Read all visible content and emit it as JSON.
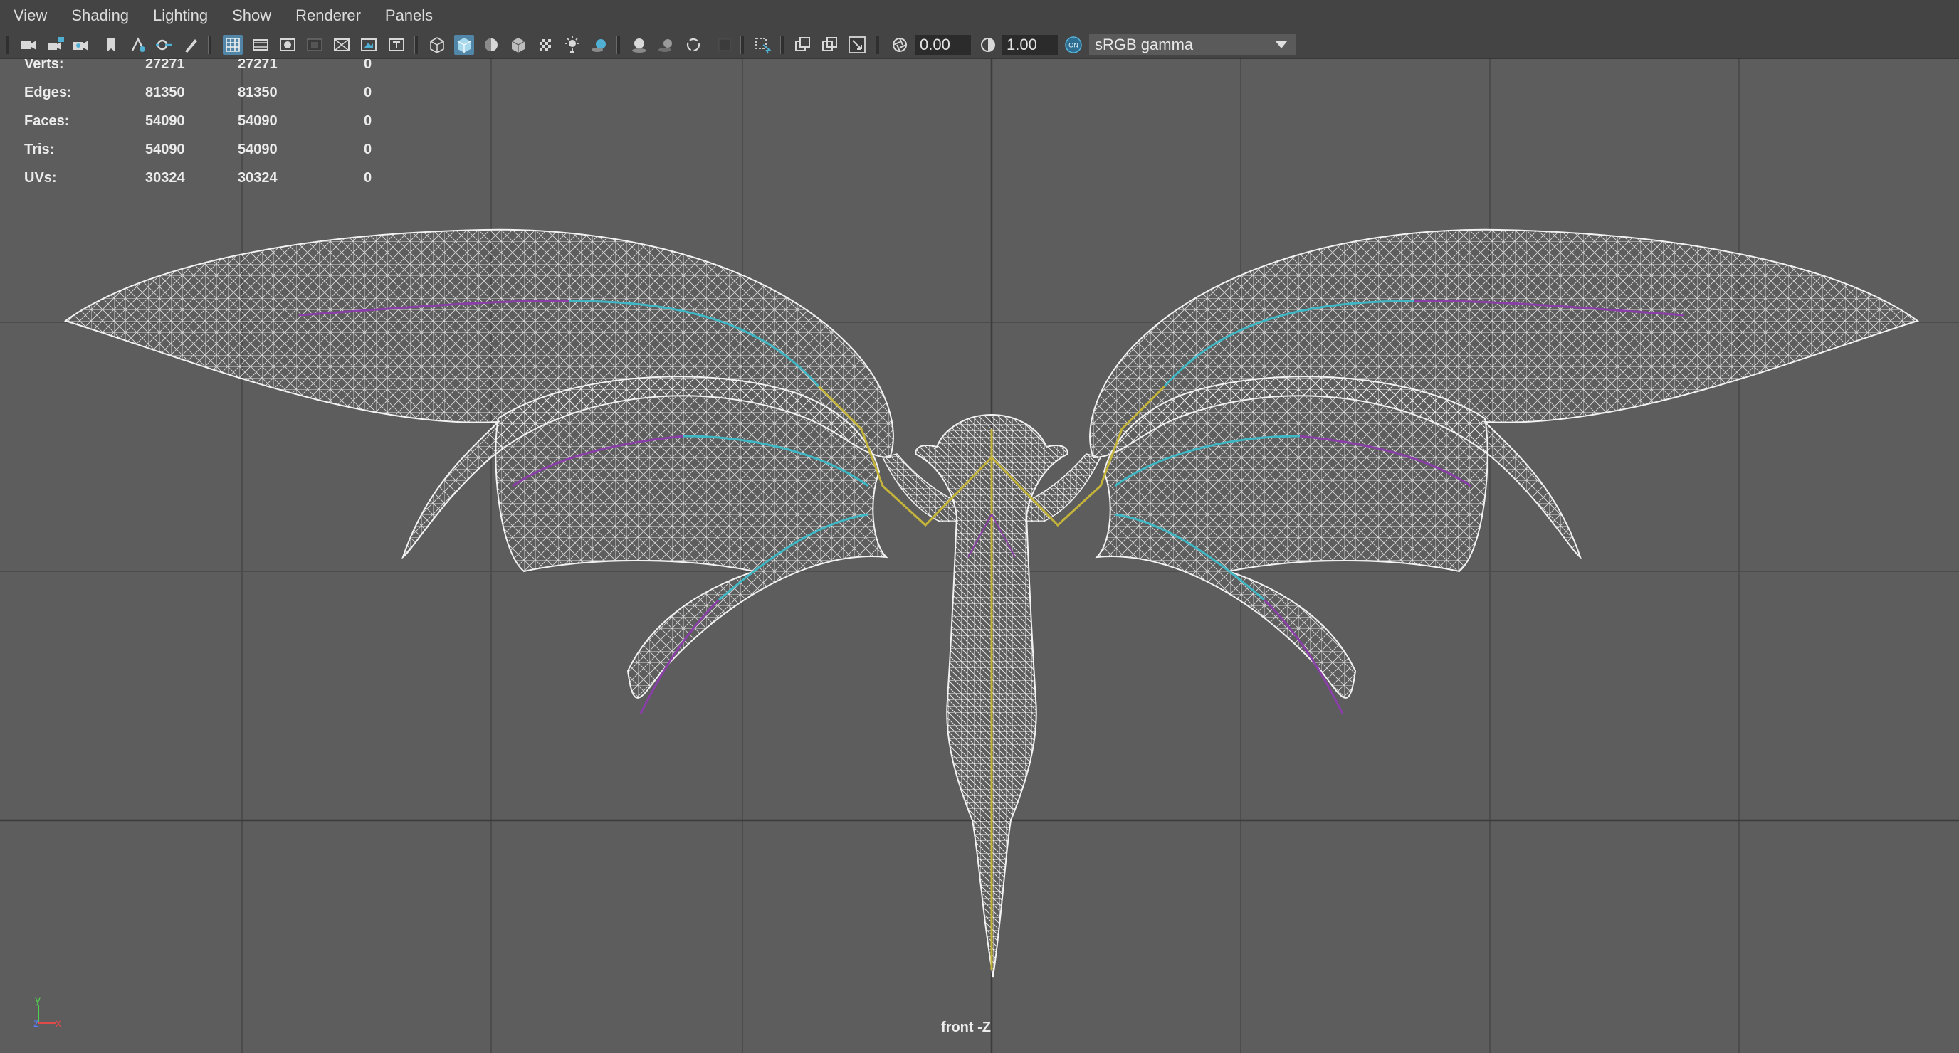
{
  "menu": {
    "items": [
      "View",
      "Shading",
      "Lighting",
      "Show",
      "Renderer",
      "Panels"
    ]
  },
  "toolbar": {
    "exposure_value": "0.00",
    "gamma_value": "1.00",
    "color_management_toggle": "ON",
    "color_space": "sRGB gamma",
    "accent_color": "#5286a8"
  },
  "hud": {
    "rows": [
      {
        "label": "Verts:",
        "value1": "27271",
        "value2": "27271",
        "value3": "0"
      },
      {
        "label": "Edges:",
        "value1": "81350",
        "value2": "81350",
        "value3": "0"
      },
      {
        "label": "Faces:",
        "value1": "54090",
        "value2": "54090",
        "value3": "0"
      },
      {
        "label": "Tris:",
        "value1": "54090",
        "value2": "54090",
        "value3": "0"
      },
      {
        "label": "UVs:",
        "value1": "30324",
        "value2": "30324",
        "value3": "0"
      }
    ]
  },
  "viewport": {
    "camera_label": "front -Z",
    "axis": {
      "y": "y",
      "z": "z",
      "x": "x"
    },
    "colors": {
      "background": "#5d5d5d",
      "grid": "#4f4f4f",
      "axis_line": "#3e3e3e",
      "wireframe": "#f0f0f0",
      "bone_cyan": "#3fb7c4",
      "bone_purple": "#8a3fa8",
      "bone_yellow": "#c4b43a"
    }
  },
  "icons": [
    "camera-icon",
    "camera-lock-icon",
    "camera-attributes-icon",
    "bookmark-icon",
    "image-plane-icon",
    "select-camera-icon",
    "grease-pencil-icon",
    "grid-icon",
    "film-gate-icon",
    "resolution-gate-icon",
    "gate-mask-icon",
    "field-chart-icon",
    "safe-action-icon",
    "safe-title-icon",
    "wireframe-icon",
    "smooth-shade-icon",
    "default-material-icon",
    "textured-icon",
    "use-lights-icon",
    "shadows-icon",
    "screen-space-ao-icon",
    "motion-blur-icon",
    "anti-aliasing-icon",
    "depth-of-field-icon",
    "isolate-select-icon",
    "xray-icon",
    "xray-active-components-icon",
    "xray-joints-icon",
    "exposure-icon",
    "gamma-icon",
    "color-management-icon"
  ]
}
